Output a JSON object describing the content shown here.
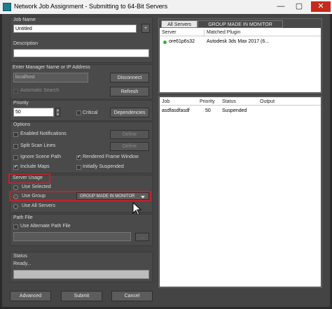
{
  "window": {
    "title": "Network Job Assignment - Submitting to 64-Bit Servers",
    "minimize": "—",
    "maximize": "▢",
    "close": "✕"
  },
  "job": {
    "name_label": "Job Name",
    "name_value": "Untitled",
    "plus_label": "+",
    "desc_label": "Description",
    "desc_value": ""
  },
  "manager": {
    "label": "Enter Manager Name or IP Address",
    "value": "localhost",
    "disconnect_label": "Disconnect",
    "auto_search_label": "Automatic Search",
    "refresh_label": "Refresh"
  },
  "priority": {
    "label": "Priority",
    "value": "50",
    "critical_label": "Critical",
    "dependencies_label": "Dependencies"
  },
  "options": {
    "label": "Options",
    "enabled_notifications": "Enabled Notifications",
    "define1": "Define",
    "split_scan_lines": "Split Scan Lines",
    "define2": "Define",
    "ignore_scene_path": "Ignore Scene Path",
    "rendered_frame_window": "Rendered Frame Window",
    "include_maps": "Include Maps",
    "initially_suspended": "Initially Suspended"
  },
  "server_usage": {
    "label": "Server Usage",
    "use_selected": "Use Selected",
    "use_group": "Use Group",
    "group_value": "GROUP MADE IN MONITOR",
    "use_all_servers": "Use All Servers"
  },
  "path_file": {
    "label": "Path File",
    "use_alternate": "Use Alternate Path File",
    "value": "",
    "browse": "..."
  },
  "status": {
    "label": "Status",
    "text": "Ready..."
  },
  "buttons": {
    "advanced": "Advanced",
    "submit": "Submit",
    "cancel": "Cancel"
  },
  "server_tabs": [
    {
      "label": "All Servers"
    },
    {
      "label": "GROUP MADE IN MONITOR"
    }
  ],
  "server_columns": {
    "server": "Server",
    "plugin": "Matched Plugin"
  },
  "servers": [
    {
      "name": "ore61p6s32",
      "plugin": "Autodesk 3ds Max 2017 (6...",
      "status_color": "#2db82d"
    }
  ],
  "job_columns": {
    "job": "Job",
    "priority": "Priority",
    "status": "Status",
    "output": "Output"
  },
  "jobs": [
    {
      "job": "asdfasdfasdf",
      "priority": "50",
      "status": "Suspended",
      "output": ""
    }
  ],
  "colors": {
    "highlight": "#c0232b",
    "background": "#444444"
  }
}
